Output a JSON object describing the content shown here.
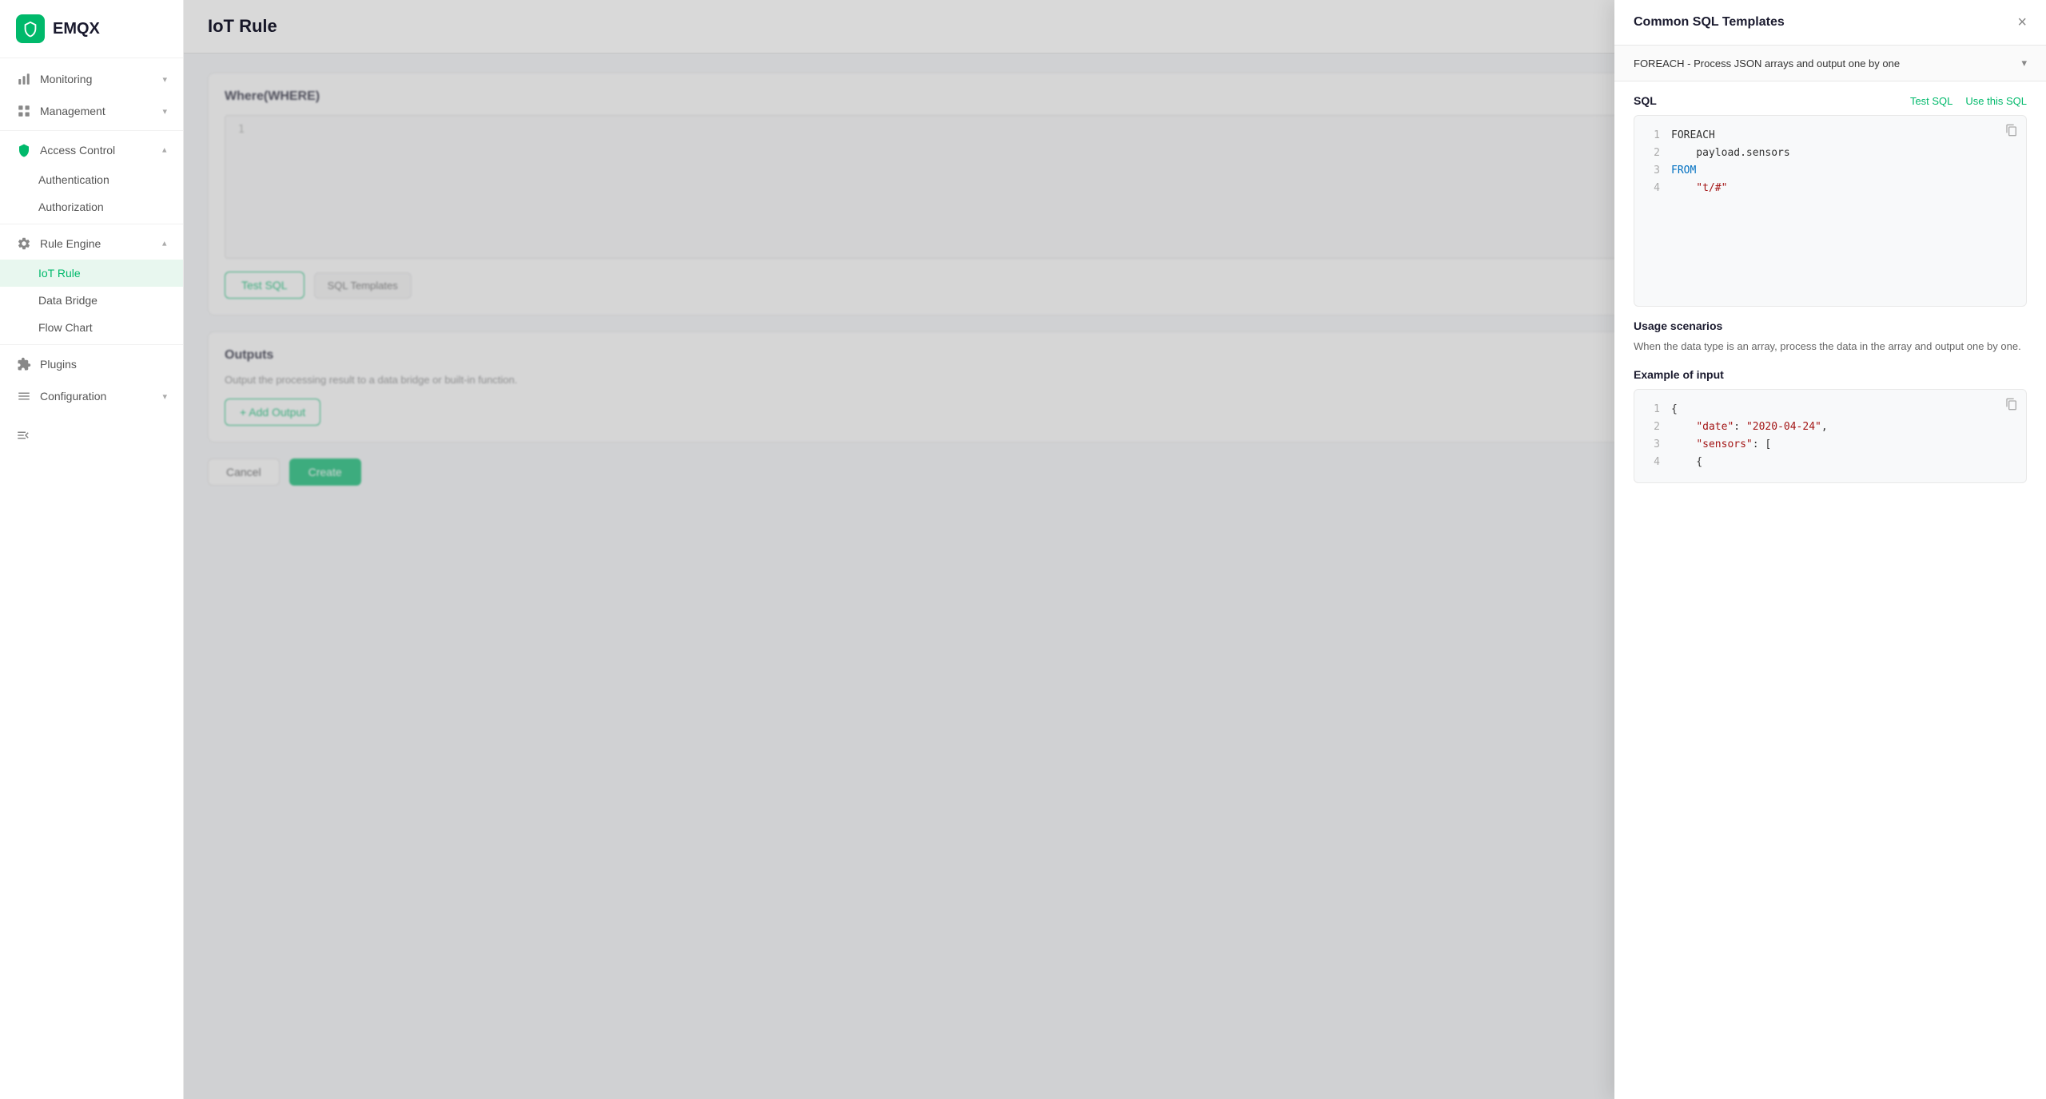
{
  "app": {
    "logo_text": "EMQX",
    "page_title": "IoT Rule"
  },
  "sidebar": {
    "items": [
      {
        "id": "monitoring",
        "label": "Monitoring",
        "icon": "chart-icon",
        "expandable": true,
        "expanded": false
      },
      {
        "id": "management",
        "label": "Management",
        "icon": "grid-icon",
        "expandable": true,
        "expanded": false
      },
      {
        "id": "access-control",
        "label": "Access Control",
        "icon": "shield-icon",
        "expandable": true,
        "expanded": true
      },
      {
        "id": "authentication",
        "label": "Authentication",
        "sub": true
      },
      {
        "id": "authorization",
        "label": "Authorization",
        "sub": true
      },
      {
        "id": "rule-engine",
        "label": "Rule Engine",
        "icon": "gear-icon",
        "expandable": true,
        "expanded": true
      },
      {
        "id": "iot-rule",
        "label": "IoT Rule",
        "sub": true,
        "active": true
      },
      {
        "id": "data-bridge",
        "label": "Data Bridge",
        "sub": true
      },
      {
        "id": "flow-chart",
        "label": "Flow Chart",
        "sub": true
      },
      {
        "id": "plugins",
        "label": "Plugins",
        "icon": "plugin-icon",
        "expandable": false
      },
      {
        "id": "configuration",
        "label": "Configuration",
        "icon": "config-icon",
        "expandable": true,
        "expanded": false
      }
    ]
  },
  "main": {
    "where_section": {
      "title": "Where(WHERE)",
      "line_number": "1"
    },
    "buttons": {
      "test_sql": "Test SQL",
      "sql_templates": "SQL Templates",
      "add_output": "+ Add Output",
      "cancel": "Cancel",
      "create": "Create"
    },
    "outputs_section": {
      "title": "Outputs",
      "description": "Output the processing result to a data bridge or built-in function."
    }
  },
  "modal": {
    "title": "Common SQL Templates",
    "close_label": "×",
    "dropdown_label": "FOREACH - Process JSON arrays and output one by one",
    "sql_section": {
      "label": "SQL",
      "test_btn": "Test SQL",
      "use_btn": "Use this SQL"
    },
    "code_lines": [
      {
        "num": "1",
        "content": "FOREACH",
        "type": "plain"
      },
      {
        "num": "2",
        "content": "    payload.sensors",
        "type": "plain"
      },
      {
        "num": "3",
        "content": "FROM",
        "type": "keyword-blue"
      },
      {
        "num": "4",
        "content": "    \"t/#\"",
        "type": "string"
      }
    ],
    "usage": {
      "title": "Usage scenarios",
      "text": "When the data type is an array, process the data in the array and output one by one."
    },
    "example_input": {
      "title": "Example of input",
      "lines": [
        {
          "num": "1",
          "content": "{",
          "type": "plain"
        },
        {
          "num": "2",
          "content": "    \"date\": \"2020-04-24\",",
          "type": "mixed-string"
        },
        {
          "num": "3",
          "content": "    \"sensors\": [",
          "type": "mixed-string"
        },
        {
          "num": "4",
          "content": "    {",
          "type": "plain"
        }
      ]
    }
  }
}
